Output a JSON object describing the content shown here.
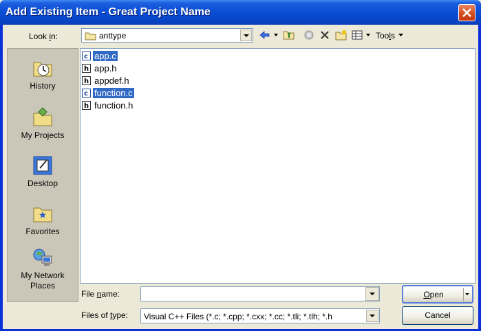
{
  "window": {
    "title": "Add Existing Item - Great Project Name"
  },
  "toolbar": {
    "look_in_label": "Look in:",
    "look_in_accel": "i",
    "look_in_value": "anttype",
    "tools_label": "Tools",
    "icons": [
      "back-icon",
      "up-folder-icon",
      "search-web-icon",
      "delete-icon",
      "new-folder-icon",
      "views-icon"
    ]
  },
  "places": [
    {
      "label": "History",
      "icon": "history-icon"
    },
    {
      "label": "My Projects",
      "icon": "my-projects-icon"
    },
    {
      "label": "Desktop",
      "icon": "desktop-icon"
    },
    {
      "label": "Favorites",
      "icon": "favorites-icon"
    },
    {
      "label": "My Network Places",
      "icon": "network-places-icon"
    }
  ],
  "files": [
    {
      "name": "app.c",
      "type": "c",
      "selected": true
    },
    {
      "name": "app.h",
      "type": "h",
      "selected": false
    },
    {
      "name": "appdef.h",
      "type": "h",
      "selected": false
    },
    {
      "name": "function.c",
      "type": "c",
      "selected": true
    },
    {
      "name": "function.h",
      "type": "h",
      "selected": false
    }
  ],
  "form": {
    "file_name_label": "File name:",
    "file_name_value": "",
    "files_of_type_label": "Files of type:",
    "files_of_type_value": "Visual C++ Files (*.c; *.cpp; *.cxx; *.cc; *.tli; *.tlh; *.h"
  },
  "buttons": {
    "open": "Open",
    "cancel": "Cancel"
  },
  "colors": {
    "selection": "#316ac5",
    "title_bar": "#0a4fd6",
    "dialog_bg": "#ece9d8"
  }
}
